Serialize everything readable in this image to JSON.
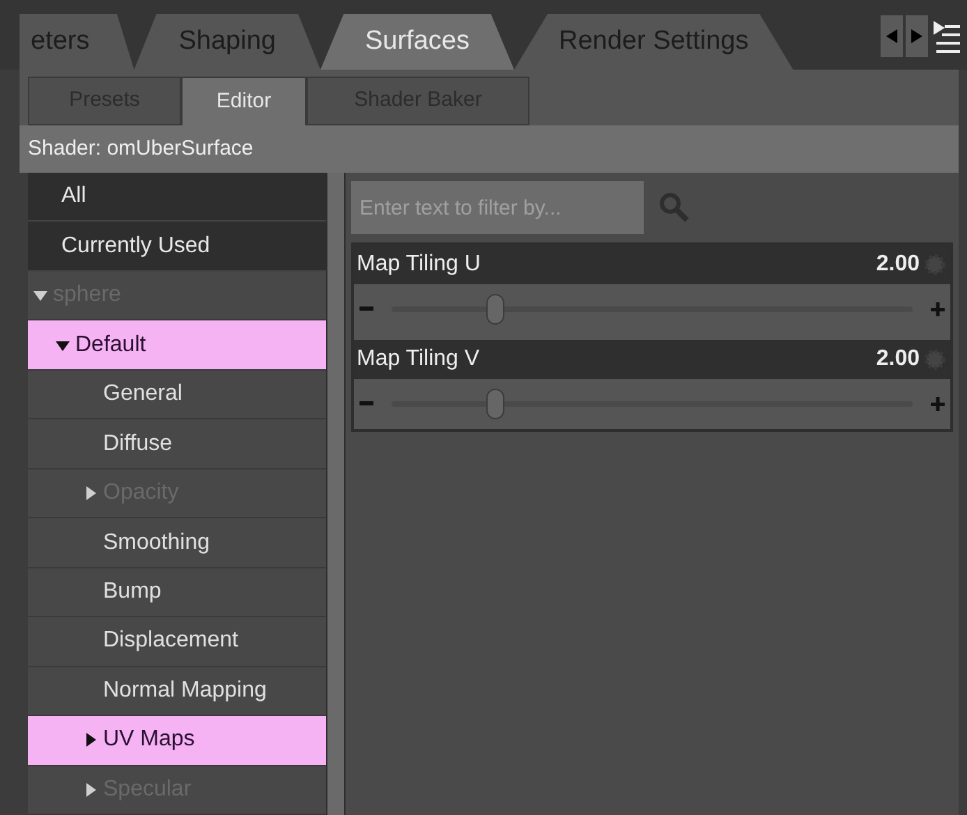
{
  "tabs": [
    {
      "label": "eters",
      "selected": false
    },
    {
      "label": "Shaping",
      "selected": false
    },
    {
      "label": "Surfaces",
      "selected": true
    },
    {
      "label": "Render Settings",
      "selected": false
    }
  ],
  "subtabs": [
    {
      "label": "Presets",
      "selected": false
    },
    {
      "label": "Editor",
      "selected": true
    },
    {
      "label": "Shader Baker",
      "selected": false
    }
  ],
  "shader_label": "Shader: omUberSurface",
  "filters": [
    {
      "label": "All",
      "selected": false
    },
    {
      "label": "Currently Used",
      "selected": false
    }
  ],
  "tree": [
    {
      "label": "sphere",
      "expanded": true,
      "dimmed": true,
      "selected": false,
      "children": [
        {
          "label": "Default",
          "expanded": true,
          "dimmed": false,
          "selected": true,
          "children": [
            {
              "label": "General",
              "dimmed": false,
              "selected": false
            },
            {
              "label": "Diffuse",
              "dimmed": false,
              "selected": false
            },
            {
              "label": "Opacity",
              "expanded": false,
              "dimmed": true,
              "selected": false
            },
            {
              "label": "Smoothing",
              "dimmed": false,
              "selected": false
            },
            {
              "label": "Bump",
              "dimmed": false,
              "selected": false
            },
            {
              "label": "Displacement",
              "dimmed": false,
              "selected": false
            },
            {
              "label": "Normal Mapping",
              "dimmed": false,
              "selected": false
            },
            {
              "label": "UV Maps",
              "expanded": false,
              "dimmed": false,
              "selected": true
            },
            {
              "label": "Specular",
              "expanded": false,
              "dimmed": true,
              "selected": false
            }
          ]
        }
      ]
    }
  ],
  "search": {
    "placeholder": "Enter text to filter by..."
  },
  "properties": [
    {
      "name": "Map Tiling U",
      "value": "2.00",
      "level": 0.2
    },
    {
      "name": "Map Tiling V",
      "value": "2.00",
      "level": 0.2
    }
  ]
}
